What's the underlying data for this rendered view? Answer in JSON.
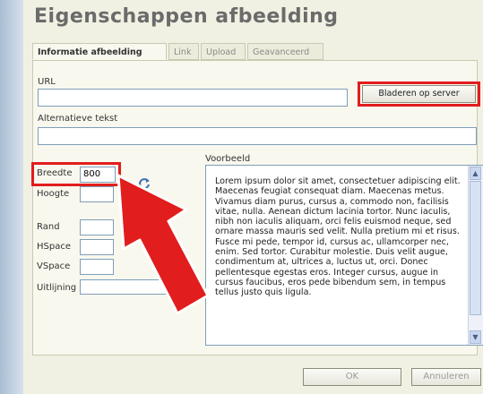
{
  "dialog": {
    "title": "Eigenschappen afbeelding"
  },
  "tabs": [
    {
      "label": "Informatie afbeelding",
      "active": true
    },
    {
      "label": "Link",
      "active": false
    },
    {
      "label": "Upload",
      "active": false
    },
    {
      "label": "Geavanceerd",
      "active": false
    }
  ],
  "form": {
    "url_label": "URL",
    "url_value": "",
    "browse_button": "Bladeren op server",
    "alt_label": "Alternatieve tekst",
    "alt_value": "",
    "width_label": "Breedte",
    "width_value": "800",
    "height_label": "Hoogte",
    "height_value": "",
    "border_label": "Rand",
    "border_value": "",
    "hspace_label": "HSpace",
    "hspace_value": "",
    "vspace_label": "VSpace",
    "vspace_value": "",
    "align_label": "Uitlijning",
    "align_value": "",
    "reset_icon": "refresh-icon"
  },
  "preview": {
    "label": "Voorbeeld",
    "text": "Lorem ipsum dolor sit amet, consectetuer adipiscing elit. Maecenas feugiat consequat diam. Maecenas metus. Vivamus diam purus, cursus a, commodo non, facilisis vitae, nulla. Aenean dictum lacinia tortor. Nunc iaculis, nibh non iaculis aliquam, orci felis euismod neque, sed ornare massa mauris sed velit. Nulla pretium mi et risus. Fusce mi pede, tempor id, cursus ac, ullamcorper nec, enim. Sed tortor. Curabitur molestie. Duis velit augue, condimentum at, ultrices a, luctus ut, orci. Donec pellentesque egestas eros. Integer cursus, augue in cursus faucibus, eros pede bibendum sem, in tempus tellus justo quis ligula."
  },
  "footer": {
    "ok_label": "OK",
    "cancel_label": "Annuleren"
  },
  "annotations": {
    "highlight_color": "#e21d1d",
    "arrow_color": "#e21d1d"
  }
}
